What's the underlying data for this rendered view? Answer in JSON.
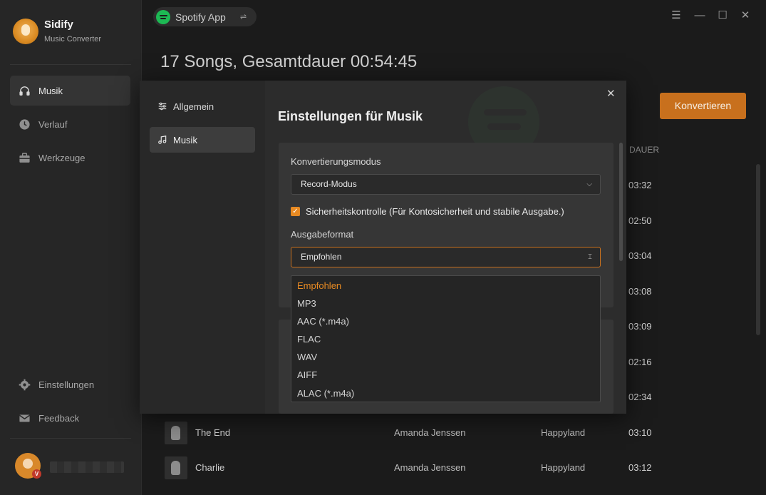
{
  "app": {
    "name": "Sidify",
    "subtitle": "Music Converter"
  },
  "sidebar": {
    "items": [
      {
        "label": "Musik",
        "icon": "headphones-icon",
        "active": true
      },
      {
        "label": "Verlauf",
        "icon": "clock-icon",
        "active": false
      },
      {
        "label": "Werkzeuge",
        "icon": "toolbox-icon",
        "active": false
      }
    ],
    "bottom_items": [
      {
        "label": "Einstellungen",
        "icon": "gear-icon"
      },
      {
        "label": "Feedback",
        "icon": "mail-icon"
      }
    ],
    "avatar_badge": "V"
  },
  "topbar": {
    "source_label": "Spotify App",
    "swap_icon": "⇌"
  },
  "window_controls": {
    "menu": "☰",
    "minimize": "—",
    "maximize": "☐",
    "close": "✕"
  },
  "main": {
    "title": "17 Songs, Gesamtdauer 00:54:45",
    "convert_label": "Konvertieren",
    "duration_header": "DAUER",
    "durations": [
      "03:32",
      "02:50",
      "03:04",
      "03:08",
      "03:09",
      "02:16",
      "02:34"
    ],
    "rows": [
      {
        "title": "The End",
        "artist": "Amanda Jenssen",
        "album": "Happyland",
        "duration": "03:10"
      },
      {
        "title": "Charlie",
        "artist": "Amanda Jenssen",
        "album": "Happyland",
        "duration": "03:12"
      }
    ]
  },
  "dialog": {
    "tabs": [
      {
        "label": "Allgemein",
        "icon": "sliders-icon",
        "active": false
      },
      {
        "label": "Musik",
        "icon": "music-note-icon",
        "active": true
      }
    ],
    "title": "Einstellungen für Musik",
    "close": "✕",
    "conversion_mode": {
      "label": "Konvertierungsmodus",
      "value": "Record-Modus"
    },
    "security_check": {
      "label": "Sicherheitskontrolle (Für Kontosicherheit und stabile Ausgabe.)",
      "checked": true
    },
    "output_format": {
      "label": "Ausgabeformat",
      "value": "Empfohlen",
      "options": [
        "Empfohlen",
        "MP3",
        "AAC (*.m4a)",
        "FLAC",
        "WAV",
        "AIFF",
        "ALAC (*.m4a)"
      ],
      "selected": "Empfohlen"
    }
  },
  "colors": {
    "accent": "#c8701d",
    "background": "#1b1b1b",
    "spotify": "#1db954"
  }
}
